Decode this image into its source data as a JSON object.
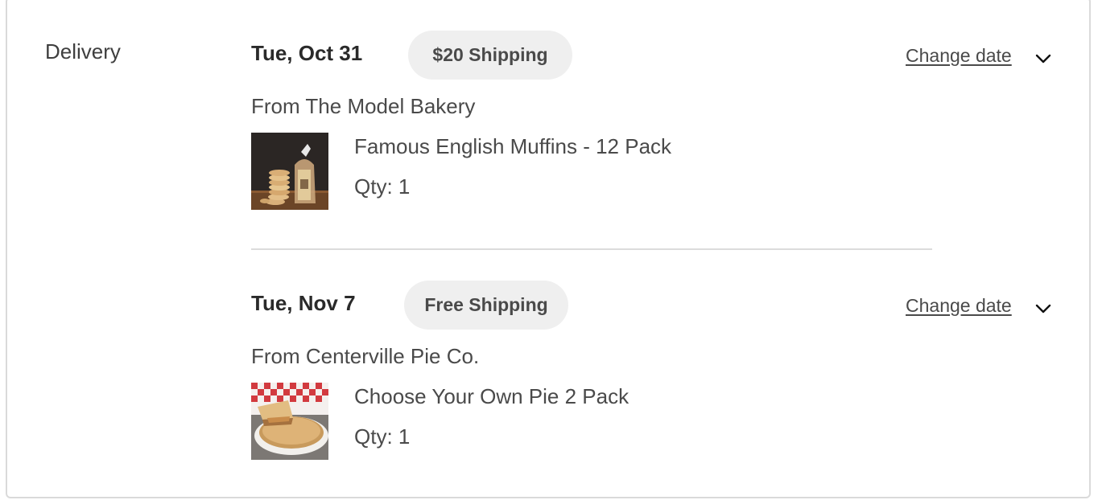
{
  "section_label": "Delivery",
  "shipments": [
    {
      "date": "Tue, Oct 31",
      "shipping_badge": "$20 Shipping",
      "change_date_label": "Change date",
      "vendor": "From The Model Bakery",
      "item": {
        "name": "Famous English Muffins - 12 Pack",
        "qty": "Qty: 1",
        "image": "english-muffins-photo"
      }
    },
    {
      "date": "Tue, Nov 7",
      "shipping_badge": "Free Shipping",
      "change_date_label": "Change date",
      "vendor": "From Centerville Pie Co.",
      "item": {
        "name": "Choose Your Own Pie 2 Pack",
        "qty": "Qty: 1",
        "image": "pie-photo"
      }
    }
  ],
  "icons": {
    "expand": "chevron-down-icon"
  },
  "colors": {
    "badge_bg": "#efefef",
    "border": "#dadada",
    "text": "#4a4a4a"
  }
}
